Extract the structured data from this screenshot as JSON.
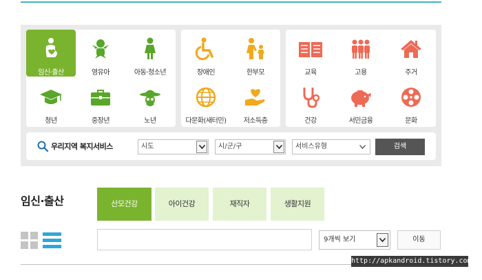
{
  "colors": {
    "accent_teal": "#3fb3c4",
    "green_active": "#7ab32e",
    "green_life": "#58a62a",
    "orange_social": "#f0a81c",
    "coral_service": "#ee6a55",
    "tab_light": "#e3f2cf",
    "search_button": "#555555",
    "list_blue": "#2fa6d9"
  },
  "categories": {
    "life_cycle": [
      {
        "label": "임신·출산",
        "icon": "pregnant-woman-icon"
      },
      {
        "label": "영유아",
        "icon": "baby-icon"
      },
      {
        "label": "아동·청소년",
        "icon": "child-icon"
      },
      {
        "label": "청년",
        "icon": "graduation-cap-icon"
      },
      {
        "label": "중장년",
        "icon": "briefcase-icon"
      },
      {
        "label": "노년",
        "icon": "elderly-hat-icon"
      }
    ],
    "social": [
      {
        "label": "장애인",
        "icon": "wheelchair-icon"
      },
      {
        "label": "한부모",
        "icon": "single-parent-icon"
      },
      {
        "label": "다문화(새터민)",
        "icon": "globe-icon"
      },
      {
        "label": "저소득층",
        "icon": "heart-hand-icon"
      }
    ],
    "service": [
      {
        "label": "교육",
        "icon": "book-icon"
      },
      {
        "label": "고용",
        "icon": "people-icon"
      },
      {
        "label": "주거",
        "icon": "house-icon"
      },
      {
        "label": "건강",
        "icon": "stethoscope-icon"
      },
      {
        "label": "서민금융",
        "icon": "piggy-bank-icon"
      },
      {
        "label": "문화",
        "icon": "film-reel-icon"
      }
    ]
  },
  "search": {
    "title": "우리지역 복지서비스",
    "sido": "시도",
    "sigungu": "시/군/구",
    "service_type": "서비스유형",
    "button": "검색"
  },
  "section": {
    "title": "임신·출산",
    "tabs": [
      "산모건강",
      "아이건강",
      "재직자",
      "생활지원"
    ]
  },
  "listing": {
    "keyword_value": "",
    "per_page": "9개씩 보기",
    "move_button": "이동"
  },
  "watermark": "http://apkandroid.tistory.com"
}
